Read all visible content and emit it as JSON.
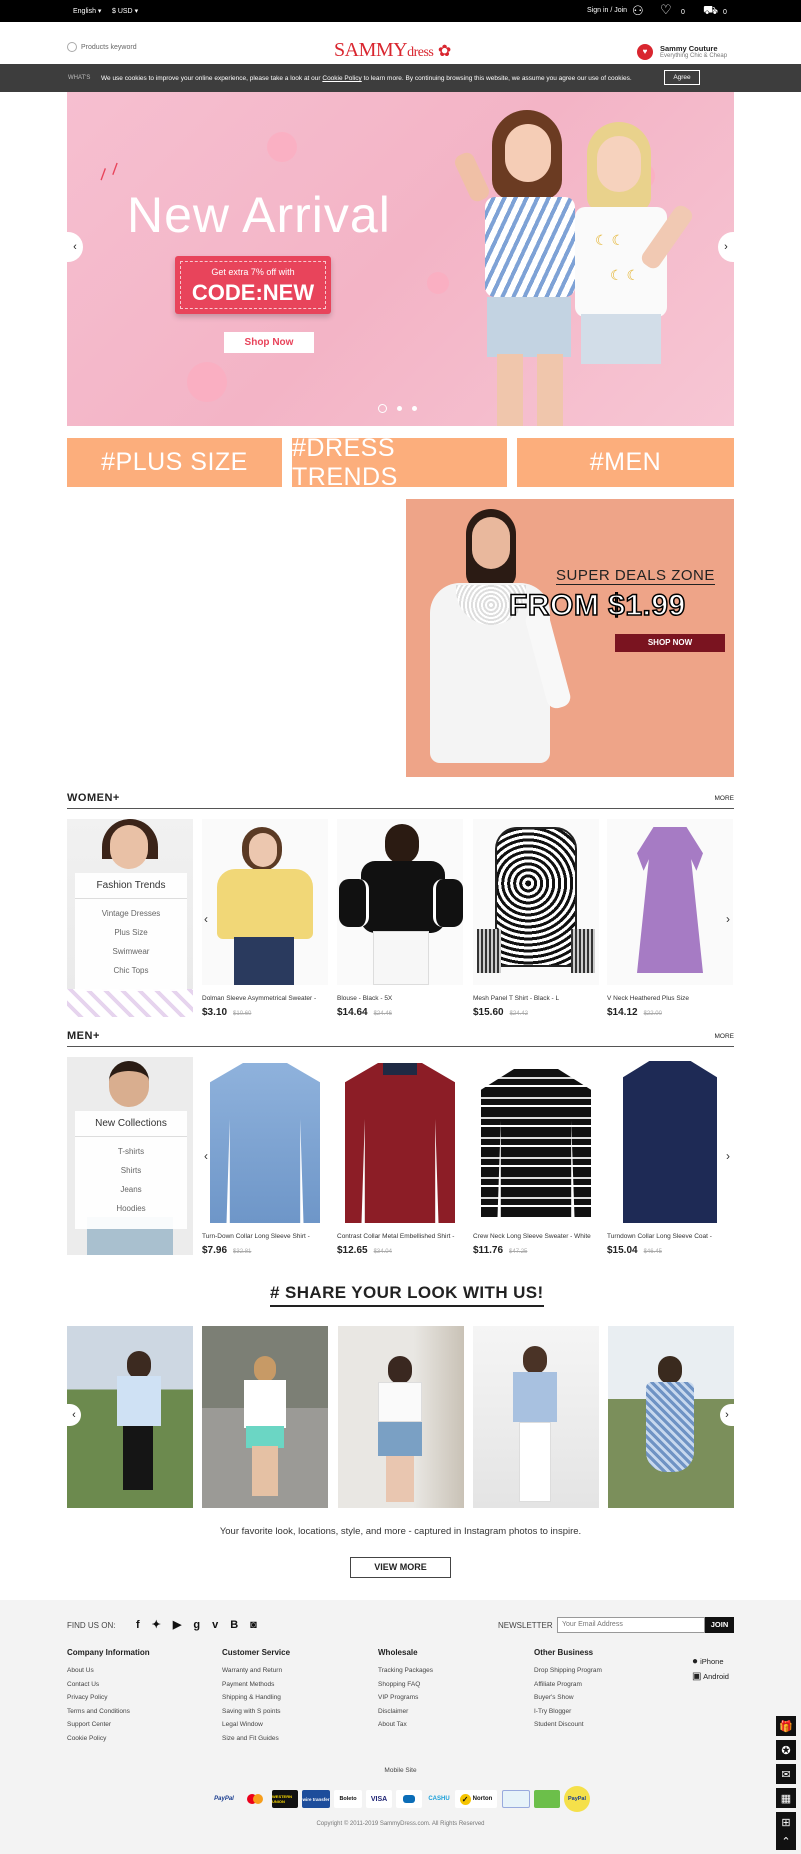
{
  "topbar": {
    "language": "English",
    "currency": "$ USD",
    "signin": "Sign in / Join",
    "wish_count": "0",
    "cart_count": "0"
  },
  "header": {
    "search_placeholder": "Products keyword",
    "logo_main": "SAMMY",
    "logo_sub": "dress",
    "brand_name": "Sammy Couture",
    "brand_tagline": "Everything Chic & Cheap",
    "whats_label": "WHAT'S"
  },
  "cookie": {
    "text_before": "We use cookies to improve your online experience, please take a look at our ",
    "link": "Cookie Policy",
    "text_after": " to learn more. By continuing browsing this website, we assume you agree our use of cookies.",
    "agree": "Agree"
  },
  "hero": {
    "title": "New Arrival",
    "promo_line": "Get extra 7% off with",
    "promo_code": "CODE:NEW",
    "cta": "Shop Now"
  },
  "tiles": [
    "#PLUS SIZE",
    "#DRESS TRENDS",
    "#MEN"
  ],
  "deals": {
    "title": "SUPER DEALS ZONE",
    "price": "FROM $1.99",
    "cta": "SHOP NOW"
  },
  "women": {
    "title": "WOMEN+",
    "more": "MORE",
    "cat_title": "Fashion Trends",
    "cat_items": [
      "Vintage Dresses",
      "Plus Size",
      "Swimwear",
      "Chic Tops"
    ],
    "products": [
      {
        "name": "Dolman Sleeve Asymmetrical Sweater -",
        "price": "$3.10",
        "old": "$10.60"
      },
      {
        "name": "Blouse - Black - 5X",
        "price": "$14.64",
        "old": "$24.46"
      },
      {
        "name": "Mesh Panel T Shirt - Black - L",
        "price": "$15.60",
        "old": "$24.42"
      },
      {
        "name": "V Neck Heathered Plus Size",
        "price": "$14.12",
        "old": "$22.00"
      }
    ]
  },
  "men": {
    "title": "MEN+",
    "more": "MORE",
    "cat_title": "New Collections",
    "cat_items": [
      "T-shirts",
      "Shirts",
      "Jeans",
      "Hoodies"
    ],
    "products": [
      {
        "name": "Turn-Down Collar Long Sleeve Shirt -",
        "price": "$7.96",
        "old": "$32.81"
      },
      {
        "name": "Contrast Collar Metal Embellished Shirt -",
        "price": "$12.65",
        "old": "$34.04"
      },
      {
        "name": "Crew Neck Long Sleeve Sweater - White",
        "price": "$11.76",
        "old": "$47.25"
      },
      {
        "name": "Turndown Collar Long Sleeve Coat -",
        "price": "$15.04",
        "old": "$46.45"
      }
    ]
  },
  "share": {
    "title": "# SHARE YOUR LOOK WITH US!",
    "text": "Your favorite look, locations, style, and more - captured in Instagram photos to inspire.",
    "button": "VIEW MORE"
  },
  "footer": {
    "find_us": "FIND US ON:",
    "newsletter_label": "NEWSLETTER",
    "newsletter_placeholder": "Your Email Address",
    "join": "JOIN",
    "columns": [
      {
        "title": "Company Information",
        "links": [
          "About Us",
          "Contact Us",
          "Privacy Policy",
          "Terms and Conditions",
          "Support Center",
          "Cookie Policy"
        ]
      },
      {
        "title": "Customer Service",
        "links": [
          "Warranty and Return",
          "Payment Methods",
          "Shipping & Handling",
          "Saving with S points",
          "Legal Window",
          "Size and Fit Guides"
        ]
      },
      {
        "title": "Wholesale",
        "links": [
          "Tracking Packages",
          "Shopping FAQ",
          "VIP Programs",
          "Disclaimer",
          "About Tax"
        ]
      },
      {
        "title": "Other Business",
        "links": [
          "Drop Shipping Program",
          "Affiliate Program",
          "Buyer's Show",
          "I-Try Blogger",
          "Student Discount"
        ]
      }
    ],
    "apps": [
      "iPhone",
      "Android"
    ],
    "mobile": "Mobile Site",
    "payments": [
      "PayPal",
      "",
      "WESTERN UNION",
      "wire transfer",
      "Boleto",
      "VISA",
      "",
      "CASHU",
      "Norton",
      "",
      "",
      "PayPal"
    ],
    "copyright": "Copyright © 2011-2019 SammyDress.com. All Rights Reserved"
  },
  "colors": {
    "accent": "#fcae7c",
    "brand": "#d9262f",
    "deals_bg": "#eea488",
    "dark": "#111111"
  }
}
